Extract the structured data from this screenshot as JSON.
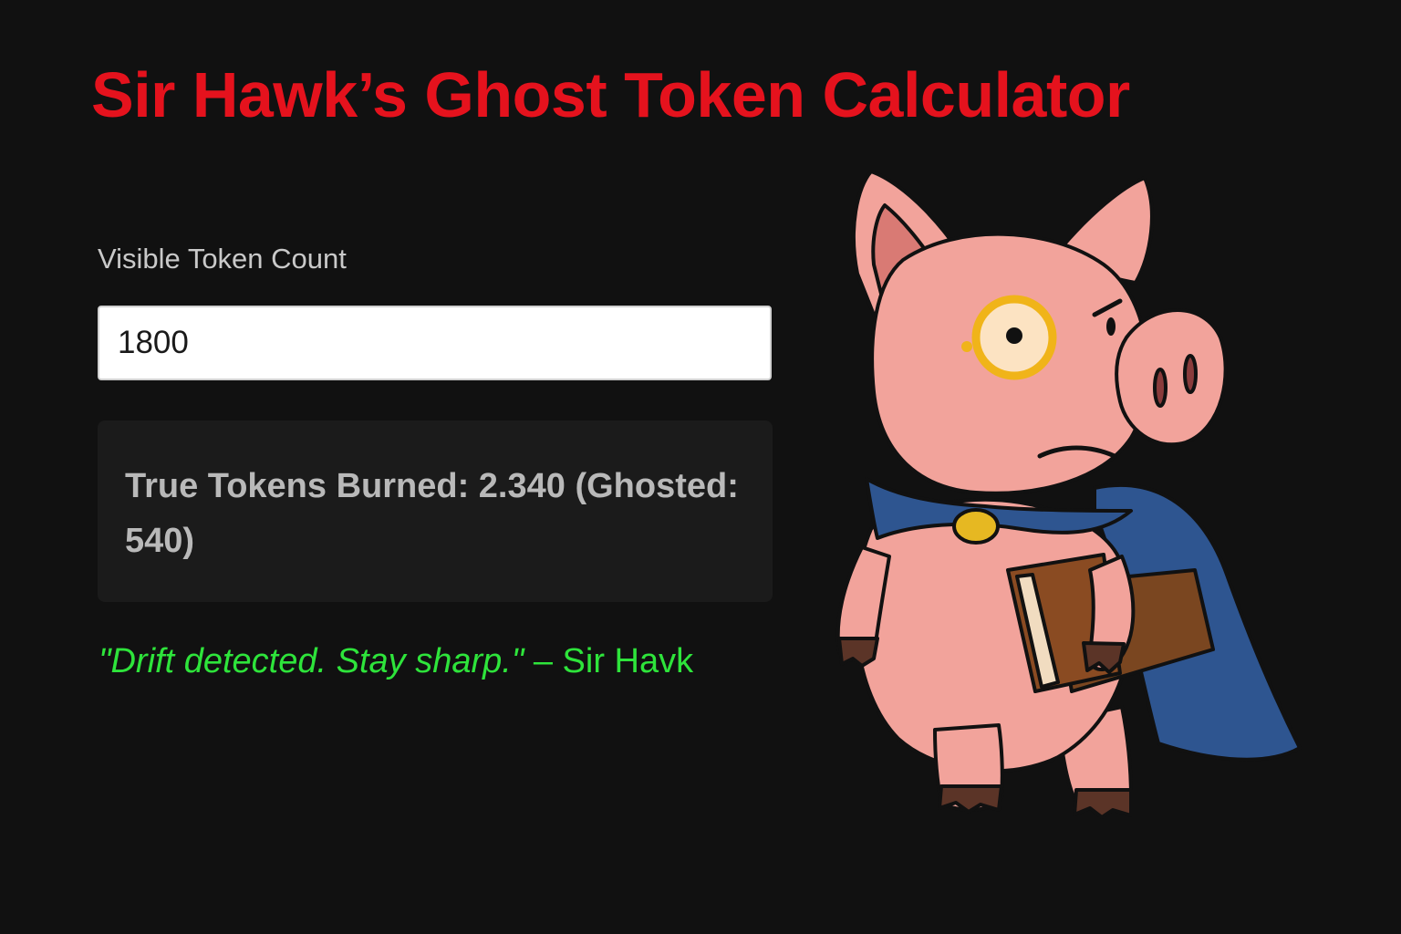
{
  "header": {
    "title": "Sir Hawk’s Ghost Token Calculator"
  },
  "form": {
    "label": "Visible Token Count",
    "input_value": "1800"
  },
  "result": {
    "text": "True Tokens Burned: 2.340 (Ghosted: 540)"
  },
  "quote": {
    "text": "\"Drift detected. Stay sharp.\"",
    "attribution": " – Sir Havk"
  },
  "colors": {
    "background": "#111111",
    "title": "#e5121d",
    "quote": "#2ee43b",
    "result_box": "#1b1b1b"
  },
  "mascot": {
    "icon": "pig-mascot-icon"
  }
}
